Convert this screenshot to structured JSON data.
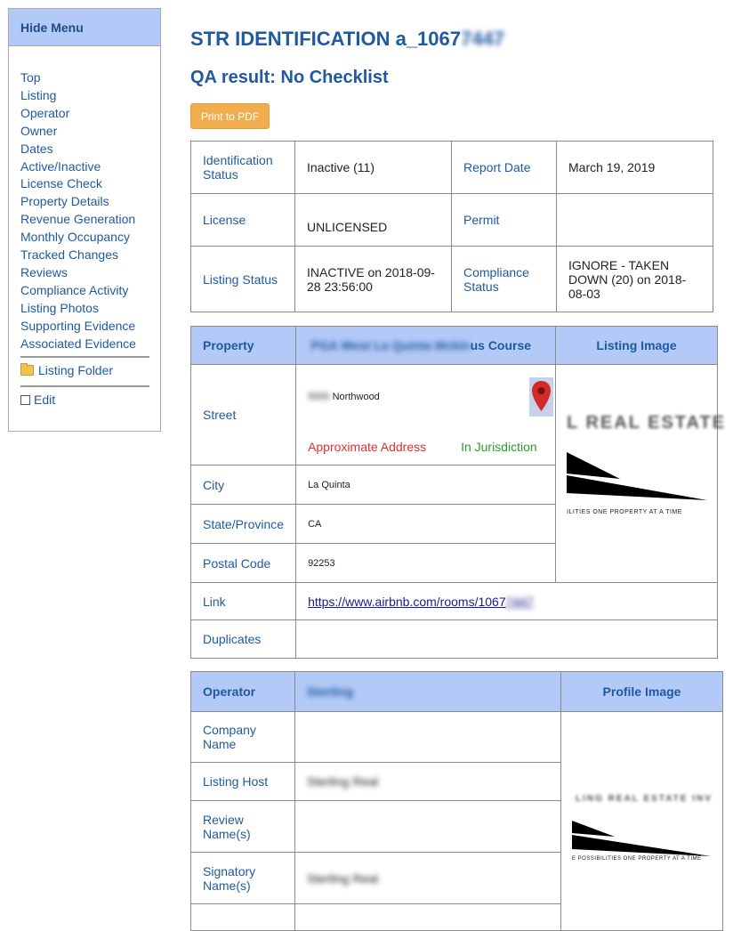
{
  "sidebar": {
    "toggle_label": "Hide Menu",
    "nav_items": [
      "Top",
      "Listing",
      "Operator",
      "Owner",
      "Dates",
      "Active/Inactive",
      "License Check",
      "Property Details",
      "Revenue Generation",
      "Monthly Occupancy",
      "Tracked Changes",
      "Reviews",
      "Compliance Activity",
      "Listing Photos",
      "Supporting Evidence",
      "Associated Evidence"
    ],
    "folder_label": "Listing Folder",
    "edit_label": "Edit"
  },
  "header": {
    "title_prefix": "STR IDENTIFICATION a_1067",
    "title_suffix": "7447",
    "qa_result": "QA result: No Checklist",
    "print_label": "Print to PDF"
  },
  "identification": {
    "status_label": "Identification Status",
    "status_value": "Inactive (11)",
    "report_date_label": "Report Date",
    "report_date_value": "March 19, 2019",
    "license_label": "License",
    "license_value": "UNLICENSED",
    "permit_label": "Permit",
    "permit_value": "",
    "listing_status_label": "Listing Status",
    "listing_status_value": "INACTIVE on 2018-09-28 23:56:00",
    "compliance_label": "Compliance Status",
    "compliance_value": "IGNORE - TAKEN DOWN (20) on 2018-08-03"
  },
  "property": {
    "header_label": "Property",
    "name_blurred": "PGA West La Quinta Mckin",
    "name_visible": "us Course",
    "listing_image_label": "Listing Image",
    "street_label": "Street",
    "street_number": "5555",
    "street_value": "Northwood",
    "approx_label": "Approximate Address",
    "jurisdiction_label": "In Jurisdiction",
    "city_label": "City",
    "city_value": "La Quinta",
    "state_label": "State/Province",
    "state_value": "CA",
    "postal_label": "Postal Code",
    "postal_value": "92253",
    "link_label": "Link",
    "link_value": "https://www.airbnb.com/rooms/1067",
    "link_tail": "7447",
    "duplicates_label": "Duplicates",
    "logo_text": "L REAL ESTATE",
    "logo_tagline": "ILITIES ONE PROPERTY AT A TIME"
  },
  "operator": {
    "header_label": "Operator",
    "name_blurred": "Sterling",
    "profile_image_label": "Profile Image",
    "company_label": "Company Name",
    "company_value": "",
    "host_label": "Listing Host",
    "host_value": "Sterling Real",
    "review_label": "Review Name(s)",
    "review_value": "",
    "signatory_label": "Signatory Name(s)",
    "signatory_value": "Sterling Real",
    "profile_logo_text": "LING REAL ESTATE INV",
    "profile_tagline": "E POSSIBILITIES ONE PROPERTY AT A TIME"
  },
  "colors": {
    "accent": "#1f5a9e",
    "header_bg": "#b3c9f7",
    "button": "#f0ad4e",
    "approx": "#e03030",
    "jurisdiction": "#2a9a2a"
  }
}
